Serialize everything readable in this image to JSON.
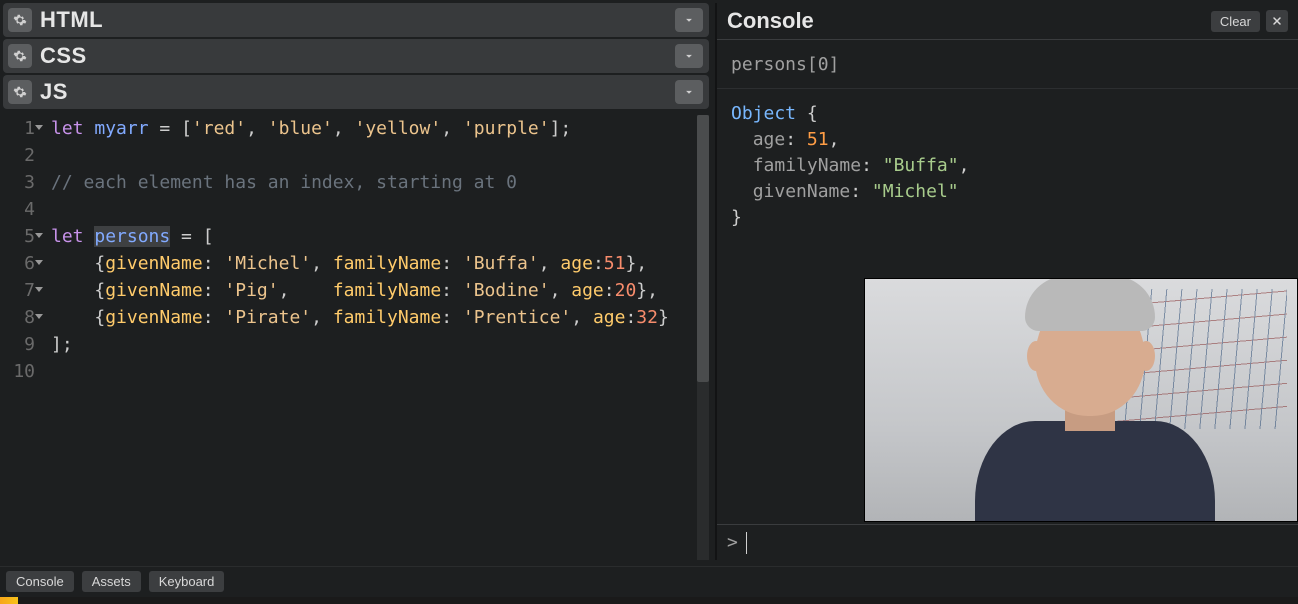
{
  "panels": {
    "html": "HTML",
    "css": "CSS",
    "js": "JS"
  },
  "editor": {
    "line_numbers": [
      "1",
      "2",
      "3",
      "4",
      "5",
      "6",
      "7",
      "8",
      "9",
      "10"
    ],
    "fold_lines": [
      1,
      5,
      6,
      7,
      8
    ],
    "code": {
      "l1": {
        "let": "let",
        "sp": " ",
        "id": "myarr",
        "eq": " = ",
        "lb": "[",
        "s1": "'red'",
        "c": ", ",
        "s2": "'blue'",
        "s3": "'yellow'",
        "s4": "'purple'",
        "rb": "];"
      },
      "l3": "// each element has an index, starting at 0",
      "l5": {
        "let": "let",
        "sp": " ",
        "id": "persons",
        "eq": " = ",
        "lb": "["
      },
      "l6": {
        "ind": "    {",
        "k1": "givenName",
        "colon": ": ",
        "v1": "'Michel'",
        "c": ", ",
        "k2": "familyName",
        "v2": "'Buffa'",
        "k3": "age",
        "colon3": ":",
        "v3": "51",
        "end": "},"
      },
      "l7": {
        "ind": "    {",
        "k1": "givenName",
        "colon": ": ",
        "v1": "'Pig'",
        "c": ",    ",
        "k2": "familyName",
        "v2": "'Bodine'",
        "k3": "age",
        "colon3": ":",
        "v3": "20",
        "end": "},"
      },
      "l8": {
        "ind": "    {",
        "k1": "givenName",
        "colon": ": ",
        "v1": "'Pirate'",
        "c": ", ",
        "k2": "familyName",
        "v2": "'Prentice'",
        "k3": "age",
        "colon3": ":",
        "v3": "32",
        "end": "}"
      },
      "l9": "];"
    }
  },
  "console": {
    "title": "Console",
    "clear": "Clear",
    "input_cmd": "persons[0]",
    "output": {
      "obj": "Object",
      "brace_open": " {",
      "k_age": "age",
      "v_age": "51",
      "k_family": "familyName",
      "v_family": "\"Buffa\"",
      "k_given": "givenName",
      "v_given": "\"Michel\"",
      "brace_close": "}"
    },
    "prompt": ">"
  },
  "footer": {
    "console": "Console",
    "assets": "Assets",
    "keyboard": "Keyboard"
  }
}
